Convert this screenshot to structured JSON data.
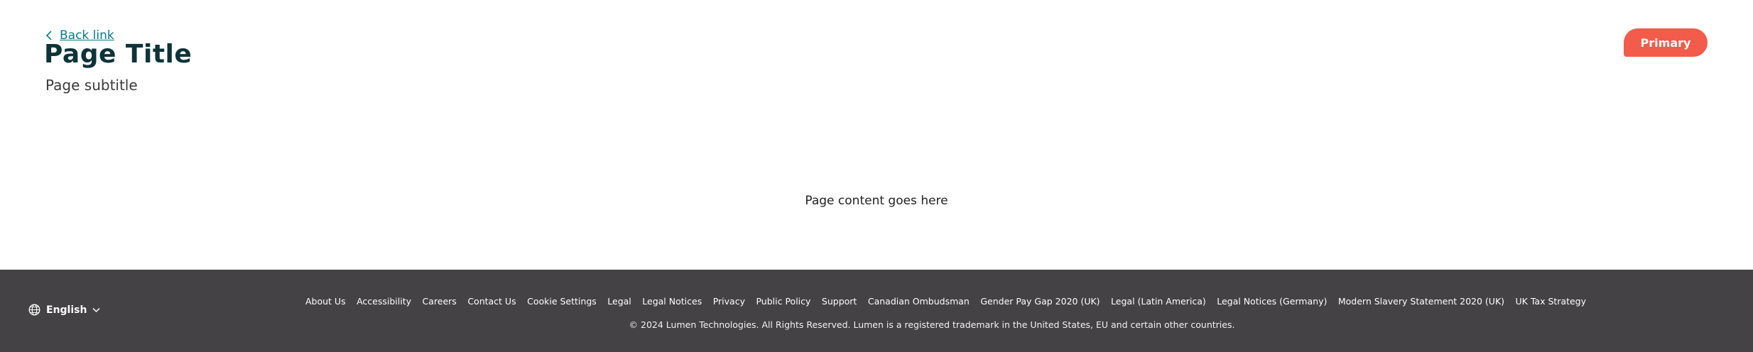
{
  "header": {
    "back_link": "Back link",
    "title": "Page Title",
    "subtitle": "Page subtitle",
    "primary_button": "Primary"
  },
  "main": {
    "content": "Page content goes here"
  },
  "footer": {
    "language": "English",
    "links": [
      "About Us",
      "Accessibility",
      "Careers",
      "Contact Us",
      "Cookie Settings",
      "Legal",
      "Legal Notices",
      "Privacy",
      "Public Policy",
      "Support",
      "Canadian Ombudsman",
      "Gender Pay Gap 2020 (UK)",
      "Legal (Latin America)",
      "Legal Notices (Germany)",
      "Modern Slavery Statement 2020 (UK)",
      "UK Tax Strategy"
    ],
    "copyright": "© 2024 Lumen Technologies. All Rights Reserved. Lumen is a registered trademark in the United States, EU and certain other countries."
  },
  "colors": {
    "primary": "#f35b4b",
    "link": "#0a7a8a",
    "title": "#0e3338",
    "footer_bg": "#444244"
  },
  "icons": {
    "back": "chevron-left-icon",
    "language": "globe-icon",
    "dropdown": "chevron-down-icon"
  }
}
